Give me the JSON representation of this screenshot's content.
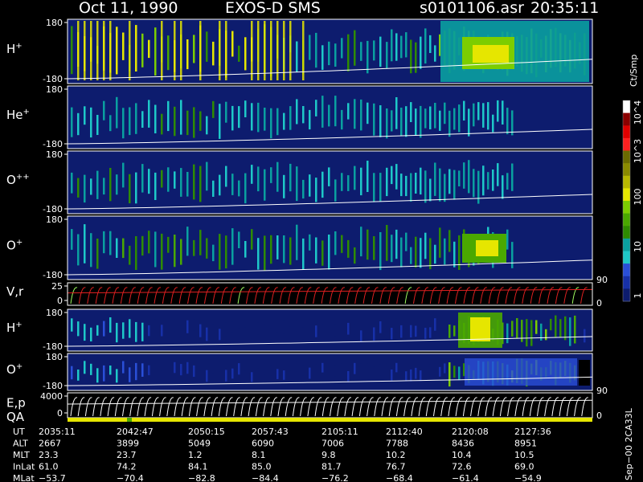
{
  "header": {
    "date": "Oct 11, 1990",
    "instrument": "EXOS-D SMS",
    "file": "s0101106.asr",
    "time": "20:35:11"
  },
  "colorbar": {
    "unit": "Ct/Smp",
    "tick_labels": [
      "10^4",
      "10^3",
      "100",
      "10",
      "1"
    ],
    "colors": [
      "#ffffff",
      "#8b0000",
      "#e00000",
      "#ff2020",
      "#6b6b00",
      "#8a8a00",
      "#b8b800",
      "#e6e600",
      "#7ccd00",
      "#4aa800",
      "#2e8b00",
      "#0aa0a0",
      "#1ec8c8",
      "#2a4fd8",
      "#1730a8",
      "#0d1c6e"
    ]
  },
  "chart_data": [
    {
      "type": "heatmap",
      "label_main": "H",
      "label_sup": "+",
      "ylim": [
        -180,
        180
      ],
      "y_ticks": [
        "180",
        "-180"
      ],
      "style": "h1"
    },
    {
      "type": "heatmap",
      "label_main": "He",
      "label_sup": "+",
      "ylim": [
        -180,
        180
      ],
      "y_ticks": [
        "180",
        "-180"
      ],
      "style": "he"
    },
    {
      "type": "heatmap",
      "label_main": "O",
      "label_sup": "++",
      "ylim": [
        -180,
        180
      ],
      "y_ticks": [
        "180",
        "-180"
      ],
      "style": "opp"
    },
    {
      "type": "heatmap",
      "label_main": "O",
      "label_sup": "+",
      "ylim": [
        -180,
        180
      ],
      "y_ticks": [
        "180",
        "-180"
      ],
      "style": "op",
      "right_tick": "90"
    },
    {
      "type": "line",
      "label_main": "V,r",
      "ylim": [
        0,
        25
      ],
      "y_ticks": [
        "25",
        "0"
      ],
      "right_tick": "0",
      "style": "vr"
    },
    {
      "type": "heatmap",
      "label_main": "H",
      "label_sup": "+",
      "ylim": [
        -180,
        180
      ],
      "y_ticks": [
        "180",
        "-180"
      ],
      "style": "h2"
    },
    {
      "type": "heatmap",
      "label_main": "O",
      "label_sup": "+",
      "ylim": [
        -180,
        180
      ],
      "y_ticks": [
        "180",
        "-180"
      ],
      "style": "o2",
      "right_tick": "90"
    },
    {
      "type": "line",
      "label_main": "E,p",
      "ylim": [
        0,
        4000
      ],
      "y_ticks": [
        "4000",
        "0"
      ],
      "right_tick": "0",
      "style": "ep"
    }
  ],
  "qa_label": "QA",
  "footer": {
    "rows": [
      {
        "name": "UT",
        "values": [
          "2035:11",
          "2042:47",
          "2050:15",
          "2057:43",
          "2105:11",
          "2112:40",
          "2120:08",
          "2127:36"
        ]
      },
      {
        "name": "ALT",
        "values": [
          "2667",
          "3899",
          "5049",
          "6090",
          "7006",
          "7788",
          "8436",
          "8951"
        ]
      },
      {
        "name": "MLT",
        "values": [
          "23.3",
          "23.7",
          "1.2",
          "8.1",
          "9.8",
          "10.2",
          "10.4",
          "10.5"
        ]
      },
      {
        "name": "InLat",
        "values": [
          "61.0",
          "74.2",
          "84.1",
          "85.0",
          "81.7",
          "76.7",
          "72.6",
          "69.0"
        ]
      },
      {
        "name": "MLat",
        "values": [
          "−53.7",
          "−70.4",
          "−82.8",
          "−84.4",
          "−76.2",
          "−68.4",
          "−61.4",
          "−54.9"
        ]
      }
    ],
    "side_note": "Sep−00 2CA33L"
  }
}
